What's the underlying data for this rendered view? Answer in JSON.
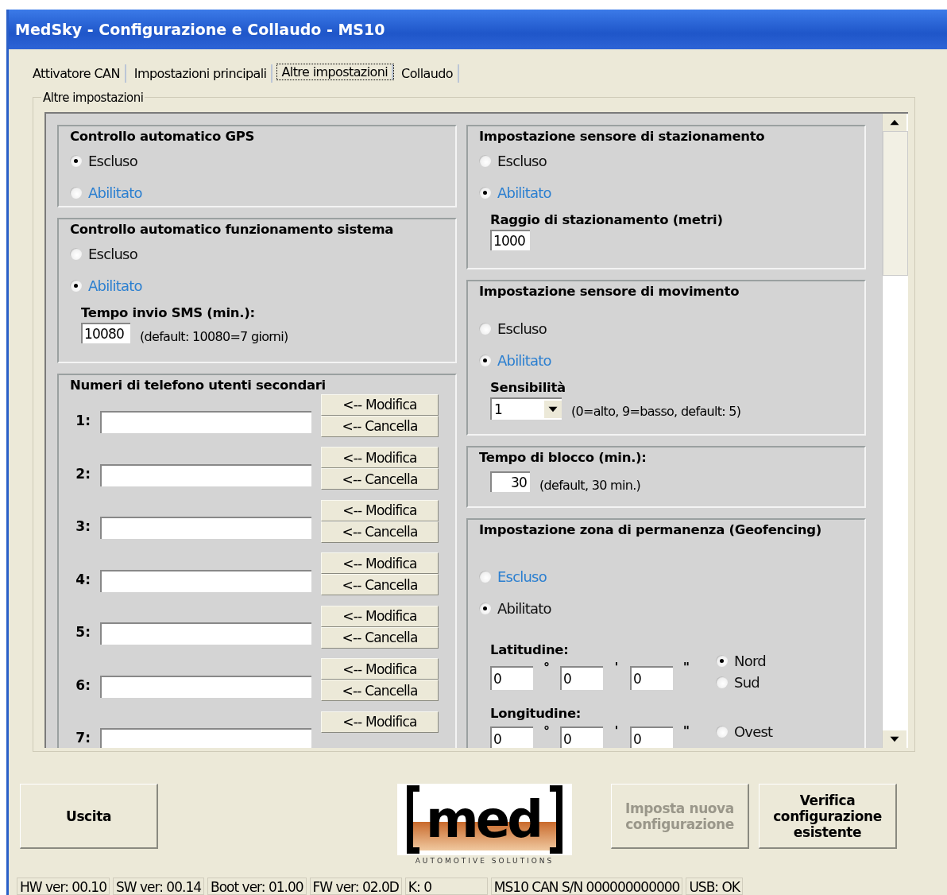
{
  "window": {
    "title": "MedSky - Configurazione e Collaudo - MS10"
  },
  "tabs": [
    {
      "label": "Attivatore CAN",
      "selected": false
    },
    {
      "label": "Impostazioni principali",
      "selected": false
    },
    {
      "label": "Altre impostazioni",
      "selected": true
    },
    {
      "label": "Collaudo",
      "selected": false
    }
  ],
  "group_title": "Altre impostazioni",
  "gps": {
    "title": "Controllo automatico GPS",
    "options": [
      {
        "label": "Escluso",
        "selected": true,
        "highlighted": false
      },
      {
        "label": "Abilitato",
        "selected": false,
        "highlighted": true
      }
    ]
  },
  "system": {
    "title": "Controllo automatico funzionamento sistema",
    "options": [
      {
        "label": "Escluso",
        "selected": false,
        "highlighted": false
      },
      {
        "label": "Abilitato",
        "selected": true,
        "highlighted": true
      }
    ],
    "field_label": "Tempo invio SMS (min.):",
    "value": "10080",
    "note": "(default: 10080=7 giorni)"
  },
  "phones": {
    "title": "Numeri di telefono utenti secondari",
    "rows": [
      {
        "number": "1:",
        "buttons": [
          "<-- Modifica",
          "<-- Cancella"
        ]
      },
      {
        "number": "2:",
        "buttons": [
          "<-- Modifica",
          "<-- Cancella"
        ]
      },
      {
        "number": "3:",
        "buttons": [
          "<-- Modifica",
          "<-- Cancella"
        ]
      },
      {
        "number": "4:",
        "buttons": [
          "<-- Modifica",
          "<-- Cancella"
        ]
      },
      {
        "number": "5:",
        "buttons": [
          "<-- Modifica",
          "<-- Cancella"
        ]
      },
      {
        "number": "6:",
        "buttons": [
          "<-- Modifica",
          "<-- Cancella"
        ]
      },
      {
        "number": "7:",
        "buttons": [
          "<-- Modifica"
        ]
      }
    ]
  },
  "parking": {
    "title": "Impostazione sensore di stazionamento",
    "options": [
      {
        "label": "Escluso",
        "selected": false,
        "highlighted": false
      },
      {
        "label": "Abilitato",
        "selected": true,
        "highlighted": true
      }
    ],
    "field_label": "Raggio di stazionamento (metri)",
    "value": "1000"
  },
  "motion": {
    "title": "Impostazione sensore di movimento",
    "options": [
      {
        "label": "Escluso",
        "selected": false,
        "highlighted": false
      },
      {
        "label": "Abilitato",
        "selected": true,
        "highlighted": true
      }
    ],
    "field_label": "Sensibilità",
    "value": "1",
    "note": "(0=alto, 9=basso, default: 5)"
  },
  "lock": {
    "title": "Tempo di blocco (min.):",
    "value": "30",
    "note": "(default, 30 min.)"
  },
  "geofence": {
    "title": "Impostazione zona di permanenza (Geofencing)",
    "options": [
      {
        "label": "Escluso",
        "selected": false,
        "highlighted": true
      },
      {
        "label": "Abilitato",
        "selected": true,
        "highlighted": false
      }
    ],
    "coords": [
      {
        "label": "Latitudine:",
        "values": [
          "0",
          "0",
          "0"
        ],
        "units": [
          "°",
          "'",
          "\""
        ],
        "hemispheres": [
          {
            "label": "Nord",
            "selected": true
          },
          {
            "label": "Sud",
            "selected": false
          }
        ]
      },
      {
        "label": "Longitudine:",
        "values": [
          "0",
          "0",
          "0"
        ],
        "units": [
          "°",
          "'",
          "\""
        ],
        "hemispheres": [
          {
            "label": "Ovest",
            "selected": false
          }
        ]
      }
    ]
  },
  "buttons": [
    {
      "label": "Uscita",
      "disabled": false
    },
    {
      "label": "Imposta nuova configurazione",
      "disabled": true
    },
    {
      "label": "Verifica configurazione esistente",
      "disabled": false
    }
  ],
  "logo": {
    "text": "med",
    "tagline": "AUTOMOTIVE SOLUTIONS"
  },
  "status_bar": [
    "HW ver: 00.10",
    "SW ver: 00.14",
    "Boot ver: 01.00",
    "FW ver: 02.0D",
    "K: 0",
    "MS10 CAN S/N 000000000000",
    "USB: OK"
  ]
}
